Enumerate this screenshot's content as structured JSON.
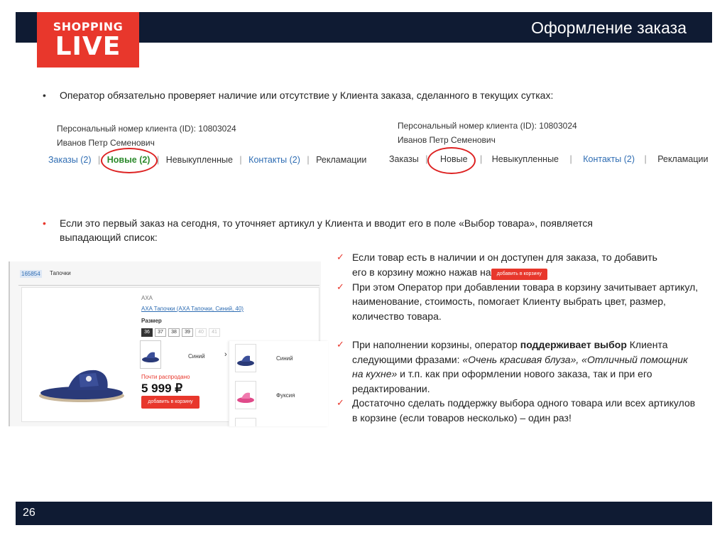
{
  "header": {
    "title": "Оформление заказа"
  },
  "logo": {
    "top": "SHOPPING",
    "bottom": "LIVE",
    "color": "#e8372c"
  },
  "colors": {
    "navy": "#0f1b33",
    "accent": "#e8372c",
    "link": "#2f6db3",
    "green": "#2d8a2d"
  },
  "bullets": {
    "first": "Оператор обязательно проверяет наличие или отсутствие у Клиента заказа, сделанного в текущих сутках:",
    "second_line1": "Если это первый заказ на сегодня, то уточняет артикул у Клиента и вводит его в поле «Выбор товара», появляется",
    "second_line2": "выпадающий список:"
  },
  "client_left": {
    "id_line": "Персональный номер клиента (ID): 10803024",
    "name_line": "Иванов Петр Семенович",
    "tabs": [
      "Заказы (2)",
      "Новые (2)",
      "Невыкупленные",
      "Контакты (2)",
      "Рекламации"
    ],
    "separator": "|"
  },
  "client_right": {
    "id_line": "Персональный номер клиента (ID): 10803024",
    "name_line": "Иванов Петр Семенович",
    "tabs": [
      "Заказы",
      "Новые",
      "Невыкупленные",
      "Контакты (2)",
      "Рекламации"
    ],
    "separator": "|"
  },
  "product": {
    "search_id": "165854",
    "search_query": "Тапочки",
    "brand": "AXA",
    "link": "AXA Тапочки (AXA Тапочки, Синий, 40)",
    "size_label": "Размер",
    "sizes": [
      "36",
      "37",
      "38",
      "39",
      "40",
      "41"
    ],
    "selected_size": "36",
    "color": "Синий",
    "stock_note": "Почти распродано",
    "price": "5 999 ₽",
    "add_button": "добавить в корзину",
    "dropdown": [
      {
        "label": "Синий"
      },
      {
        "label": "Фуксия"
      }
    ]
  },
  "checklist": {
    "item1_a": "Если товар есть в наличии и он доступен для заказа, то добавить",
    "item1_b": "его в корзину можно нажав на",
    "item1_button": "добавить в корзину",
    "item2": "При этом Оператор при добавлении товара в корзину зачитывает артикул, наименование, стоимость, помогает Клиенту выбрать цвет, размер, количество товара.",
    "item3_a": "При наполнении корзины, оператор ",
    "item3_bold": "поддерживает выбор",
    "item3_b": " Клиента следующими фразами: ",
    "item3_italic": "«Очень красивая блуза», «Отличный помощник на кухне»",
    "item3_c": " и т.п. как при оформлении нового заказа, так и при его редактировании.",
    "item4": "Достаточно сделать поддержку выбора одного товара или всех артикулов в корзине (если товаров несколько) – один раз!"
  },
  "footer": {
    "page": "26"
  }
}
